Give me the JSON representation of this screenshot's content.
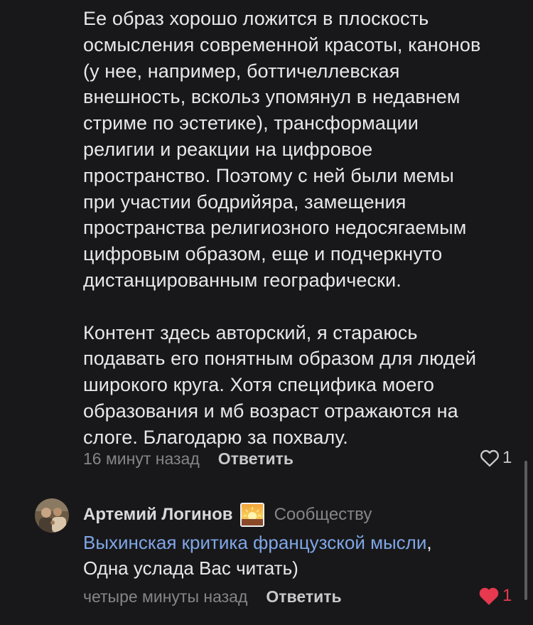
{
  "comment": {
    "text_paragraph_1": "Ее образ хорошо ложится в плоскость\nосмысления современной красоты, канонов\n(у нее, например, боттичеллевская\nвнешность, вскольз упомянул в недавнем\nстриме по эстетике), трансформации\nрелигии и реакции на цифровое\nпространство. Поэтому с ней были мемы\nпри участии бодрийяра, замещения\nпространства религиозного недосягаемым\nцифровым образом, еще и подчеркнуто\nдистанцированным географически.",
    "text_paragraph_2": "Контент здесь авторский, я стараюсь\nподавать его понятным образом для людей\nширокого круга. Хотя специфика моего\nобразования и мб возраст отражаются на\nслоге. Благодарю за похвалу.",
    "time": "16 минут назад",
    "reply_label": "Ответить",
    "like_count": "1",
    "liked": false
  },
  "reply": {
    "author": "Артемий Логинов",
    "author_badge_icon": "sunset-emoji",
    "author_role": "Сообществу",
    "mention": "Выхинская критика французской мысли",
    "text_after_mention": ",",
    "text": "Одна услада Вас читать)",
    "time": "четыре минуты назад",
    "reply_label": "Ответить",
    "like_count": "1",
    "liked": true,
    "like_color": "#e6384f"
  }
}
